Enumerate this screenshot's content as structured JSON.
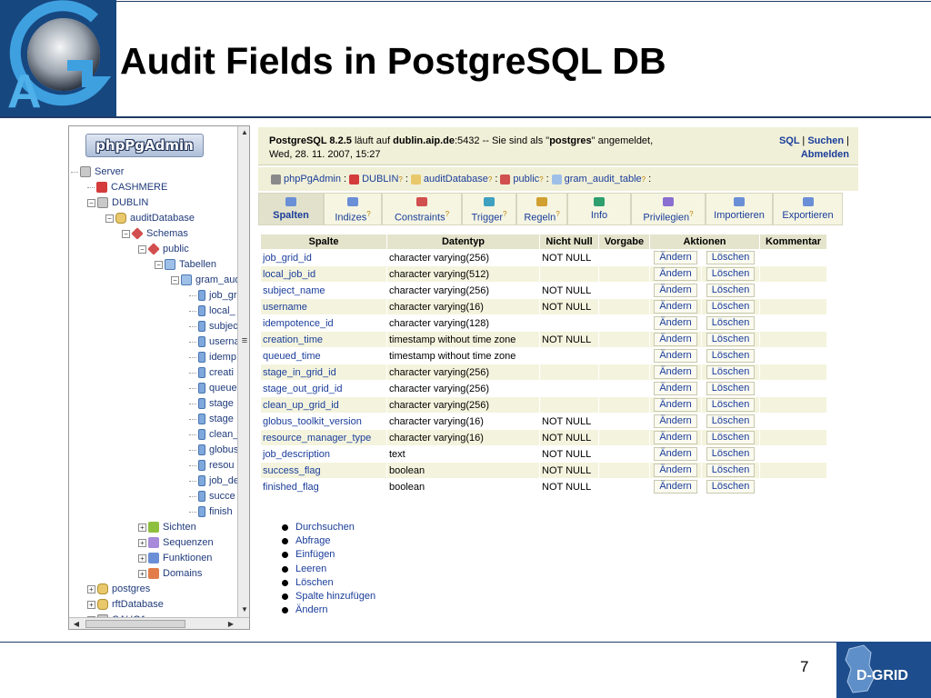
{
  "slide": {
    "title": "Audit Fields in PostgreSQL DB",
    "page_number": "7",
    "logo_left_text": "A",
    "logo_right_text": "D-GRID"
  },
  "tree": {
    "logo_text": "phpPgAdmin",
    "nodes": [
      {
        "label": "Server",
        "icon": "server-icon"
      },
      {
        "label": "CASHMERE",
        "icon": "server-error-icon"
      },
      {
        "label": "DUBLIN",
        "icon": "server-icon"
      },
      {
        "label": "auditDatabase",
        "icon": "database-icon"
      },
      {
        "label": "Schemas",
        "icon": "schemas-icon"
      },
      {
        "label": "public",
        "icon": "schema-icon"
      },
      {
        "label": "Tabellen",
        "icon": "tables-icon"
      },
      {
        "label": "gram_aud",
        "icon": "table-icon"
      },
      {
        "label": "job_gr",
        "icon": "column-icon"
      },
      {
        "label": "local_",
        "icon": "column-icon"
      },
      {
        "label": "subjec",
        "icon": "column-icon"
      },
      {
        "label": "userna",
        "icon": "column-icon"
      },
      {
        "label": "idemp",
        "icon": "column-icon"
      },
      {
        "label": "creati",
        "icon": "column-icon"
      },
      {
        "label": "queue",
        "icon": "column-icon"
      },
      {
        "label": "stage",
        "icon": "column-icon"
      },
      {
        "label": "stage",
        "icon": "column-icon"
      },
      {
        "label": "clean_",
        "icon": "column-icon"
      },
      {
        "label": "globus",
        "icon": "column-icon"
      },
      {
        "label": "resou",
        "icon": "column-icon"
      },
      {
        "label": "job_de",
        "icon": "column-icon"
      },
      {
        "label": "succe",
        "icon": "column-icon"
      },
      {
        "label": "finish",
        "icon": "column-icon"
      },
      {
        "label": "Sichten",
        "icon": "views-icon"
      },
      {
        "label": "Sequenzen",
        "icon": "sequences-icon"
      },
      {
        "label": "Funktionen",
        "icon": "functions-icon"
      },
      {
        "label": "Domains",
        "icon": "domains-icon"
      },
      {
        "label": "postgres",
        "icon": "database-icon"
      },
      {
        "label": "rftDatabase",
        "icon": "database-icon"
      },
      {
        "label": "CAHO1",
        "icon": "server-icon"
      }
    ]
  },
  "topbar": {
    "product": "PostgreSQL 8.2.5",
    "runs_on": " läuft auf ",
    "host": "dublin.aip.de",
    "port_text": ":5432 -- Sie sind als \"",
    "user": "postgres",
    "logged_in": "\" angemeldet,",
    "date": "Wed, 28. 11. 2007, 15:27",
    "link_sql": "SQL",
    "link_search": "Suchen",
    "link_logout": "Abmelden",
    "sep": "|"
  },
  "breadcrumb": {
    "items": [
      {
        "label": "phpPgAdmin",
        "icon": "elephant-icon"
      },
      {
        "label": "DUBLIN",
        "icon": "server-icon"
      },
      {
        "label": "auditDatabase",
        "icon": "database-icon"
      },
      {
        "label": "public",
        "icon": "schema-icon"
      },
      {
        "label": "gram_audit_table",
        "icon": "table-icon"
      }
    ],
    "help_mark": "?",
    "colon": ":"
  },
  "tabs": [
    {
      "label": "Spalten",
      "active": true,
      "help": ""
    },
    {
      "label": "Indizes",
      "active": false,
      "help": "?"
    },
    {
      "label": "Constraints",
      "active": false,
      "help": "?"
    },
    {
      "label": "Trigger",
      "active": false,
      "help": "?"
    },
    {
      "label": "Regeln",
      "active": false,
      "help": "?"
    },
    {
      "label": "Info",
      "active": false,
      "help": ""
    },
    {
      "label": "Privilegien",
      "active": false,
      "help": "?"
    },
    {
      "label": "Importieren",
      "active": false,
      "help": ""
    },
    {
      "label": "Exportieren",
      "active": false,
      "help": ""
    }
  ],
  "columns_table": {
    "headers": [
      "Spalte",
      "Datentyp",
      "Nicht Null",
      "Vorgabe",
      "Aktionen",
      "Kommentar"
    ],
    "edit_label": "Ändern",
    "delete_label": "Löschen",
    "rows": [
      {
        "name": "job_grid_id",
        "type": "character varying(256)",
        "not_null": "NOT NULL",
        "default": ""
      },
      {
        "name": "local_job_id",
        "type": "character varying(512)",
        "not_null": "",
        "default": ""
      },
      {
        "name": "subject_name",
        "type": "character varying(256)",
        "not_null": "NOT NULL",
        "default": ""
      },
      {
        "name": "username",
        "type": "character varying(16)",
        "not_null": "NOT NULL",
        "default": ""
      },
      {
        "name": "idempotence_id",
        "type": "character varying(128)",
        "not_null": "",
        "default": ""
      },
      {
        "name": "creation_time",
        "type": "timestamp without time zone",
        "not_null": "NOT NULL",
        "default": ""
      },
      {
        "name": "queued_time",
        "type": "timestamp without time zone",
        "not_null": "",
        "default": ""
      },
      {
        "name": "stage_in_grid_id",
        "type": "character varying(256)",
        "not_null": "",
        "default": ""
      },
      {
        "name": "stage_out_grid_id",
        "type": "character varying(256)",
        "not_null": "",
        "default": ""
      },
      {
        "name": "clean_up_grid_id",
        "type": "character varying(256)",
        "not_null": "",
        "default": ""
      },
      {
        "name": "globus_toolkit_version",
        "type": "character varying(16)",
        "not_null": "NOT NULL",
        "default": ""
      },
      {
        "name": "resource_manager_type",
        "type": "character varying(16)",
        "not_null": "NOT NULL",
        "default": ""
      },
      {
        "name": "job_description",
        "type": "text",
        "not_null": "NOT NULL",
        "default": ""
      },
      {
        "name": "success_flag",
        "type": "boolean",
        "not_null": "NOT NULL",
        "default": ""
      },
      {
        "name": "finished_flag",
        "type": "boolean",
        "not_null": "NOT NULL",
        "default": ""
      }
    ]
  },
  "actions": [
    "Durchsuchen",
    "Abfrage",
    "Einfügen",
    "Leeren",
    "Löschen",
    "Spalte hinzufügen",
    "Ändern"
  ],
  "colors": {
    "link": "#1a3d9a",
    "title_bar": "#f0f0d8",
    "header_line": "#1f3b66"
  }
}
